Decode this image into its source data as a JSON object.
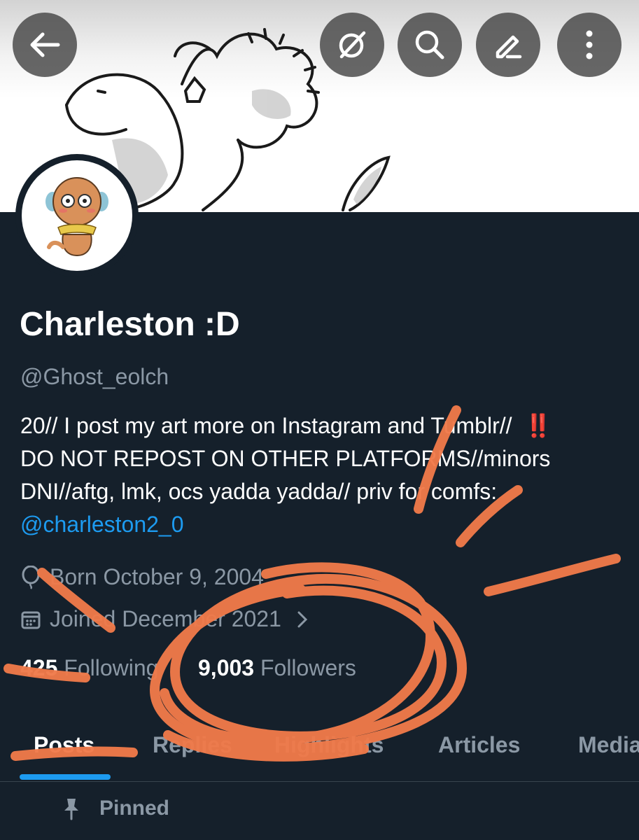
{
  "header": {
    "back_icon": "arrow-left-icon",
    "actions": [
      "grok-icon",
      "search-icon",
      "edit-icon",
      "more-vertical-icon"
    ]
  },
  "profile": {
    "name": "Charleston :D",
    "handle": "@Ghost_eolch",
    "bio_lines": [
      "20// I post my art more on Instagram and Tumblr//",
      "DO NOT REPOST ON OTHER PLATFORMS//minors",
      "DNI//aftg, lmk, ocs yadda yadda// priv for comfs:"
    ],
    "bio_emoji": "‼️",
    "bio_mention": "@charleston2_0",
    "birthday": "Born October 9, 2004",
    "joined": "Joined December 2021",
    "following_count": "425",
    "following_label": "Following",
    "followers_count": "9,003",
    "followers_label": "Followers"
  },
  "tabs": [
    "Posts",
    "Replies",
    "Highlights",
    "Articles",
    "Media"
  ],
  "active_tab": "Posts",
  "pinned_label": "Pinned",
  "colors": {
    "background": "#15202b",
    "accent": "#1d9bf0",
    "secondary_text": "#8b98a5",
    "scribble": "#f07a4a"
  }
}
